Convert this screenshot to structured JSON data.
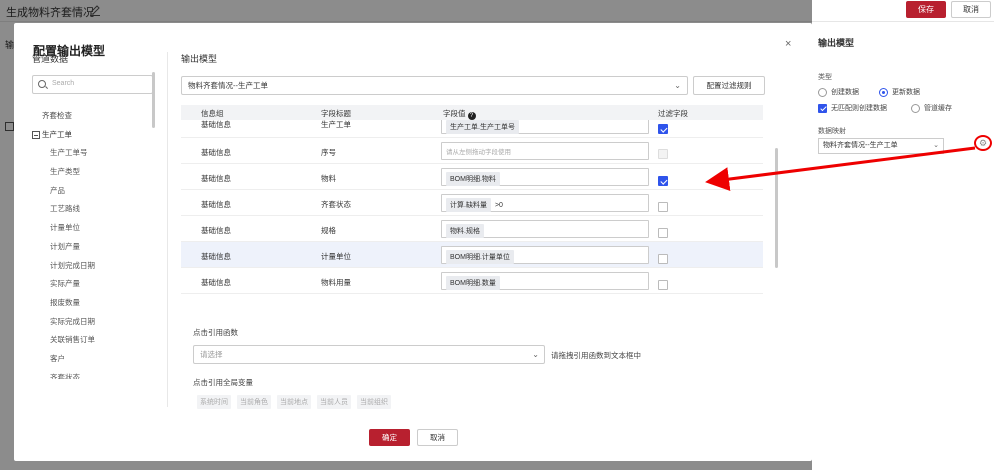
{
  "page": {
    "title": "生成物料齐套情况",
    "save_label": "保存",
    "cancel_label": "取消",
    "left_label": "输"
  },
  "right_panel": {
    "title": "输出模型",
    "type_label": "类型",
    "radio_create": "创建数据",
    "radio_update": "更新数据",
    "check_unmatched": "无匹配则创建数据",
    "radio_pipeline_cache": "管道缓存",
    "mapping_label": "数据映射",
    "mapping_value": "物料齐套情况--生产工单"
  },
  "modal": {
    "title": "配置输出模型",
    "close": "×",
    "left": {
      "title": "管道数据",
      "search_placeholder": "Search",
      "root": "齐套检查",
      "parent": "生产工单",
      "children": [
        "生产工单号",
        "生产类型",
        "产品",
        "工艺路线",
        "计量单位",
        "计划产量",
        "计划完成日期",
        "实际产量",
        "报废数量",
        "实际完成日期",
        "关联销售订单",
        "客户",
        "齐套状态"
      ]
    },
    "right": {
      "title": "输出模型",
      "model_value": "物料齐套情况--生产工单",
      "filter_rules_button": "配置过滤规则",
      "columns": {
        "group": "信息组",
        "field_title": "字段标题",
        "field_value": "字段值",
        "help": "?",
        "filter": "过滤字段"
      },
      "rows": [
        {
          "group": "基础信息",
          "field": "生产工单",
          "chips": [
            "生产工单.生产工单号"
          ],
          "extra": "",
          "placeholder": "",
          "filter": "checked"
        },
        {
          "group": "基础信息",
          "field": "序号",
          "chips": [],
          "extra": "",
          "placeholder": "请从左侧拖动字段使用",
          "filter": "disabled"
        },
        {
          "group": "基础信息",
          "field": "物料",
          "chips": [
            "BOM明细.物料"
          ],
          "extra": "",
          "placeholder": "",
          "filter": "checked"
        },
        {
          "group": "基础信息",
          "field": "齐套状态",
          "chips": [
            "计算.缺料量"
          ],
          "extra": ">0",
          "placeholder": "",
          "filter": "unchecked"
        },
        {
          "group": "基础信息",
          "field": "规格",
          "chips": [
            "物料.规格"
          ],
          "extra": "",
          "placeholder": "",
          "filter": "unchecked"
        },
        {
          "group": "基础信息",
          "field": "计量单位",
          "chips": [
            "BOM明细.计量单位"
          ],
          "extra": "",
          "placeholder": "",
          "filter": "unchecked"
        },
        {
          "group": "基础信息",
          "field": "物料用量",
          "chips": [
            "BOM明细.数量"
          ],
          "extra": "",
          "placeholder": "",
          "filter": "unchecked"
        }
      ],
      "function_label": "点击引用函数",
      "function_placeholder": "请选择",
      "function_hint": "请拖拽引用函数到文本框中",
      "global_var_label": "点击引用全局变量",
      "global_vars": [
        "系统时间",
        "当前角色",
        "当前地点",
        "当前人员",
        "当前组织"
      ]
    },
    "ok_label": "确定",
    "cancel_label": "取消"
  },
  "colors": {
    "primary": "#b8202f",
    "accent": "#2f54eb",
    "annotation": "#ee0000"
  }
}
